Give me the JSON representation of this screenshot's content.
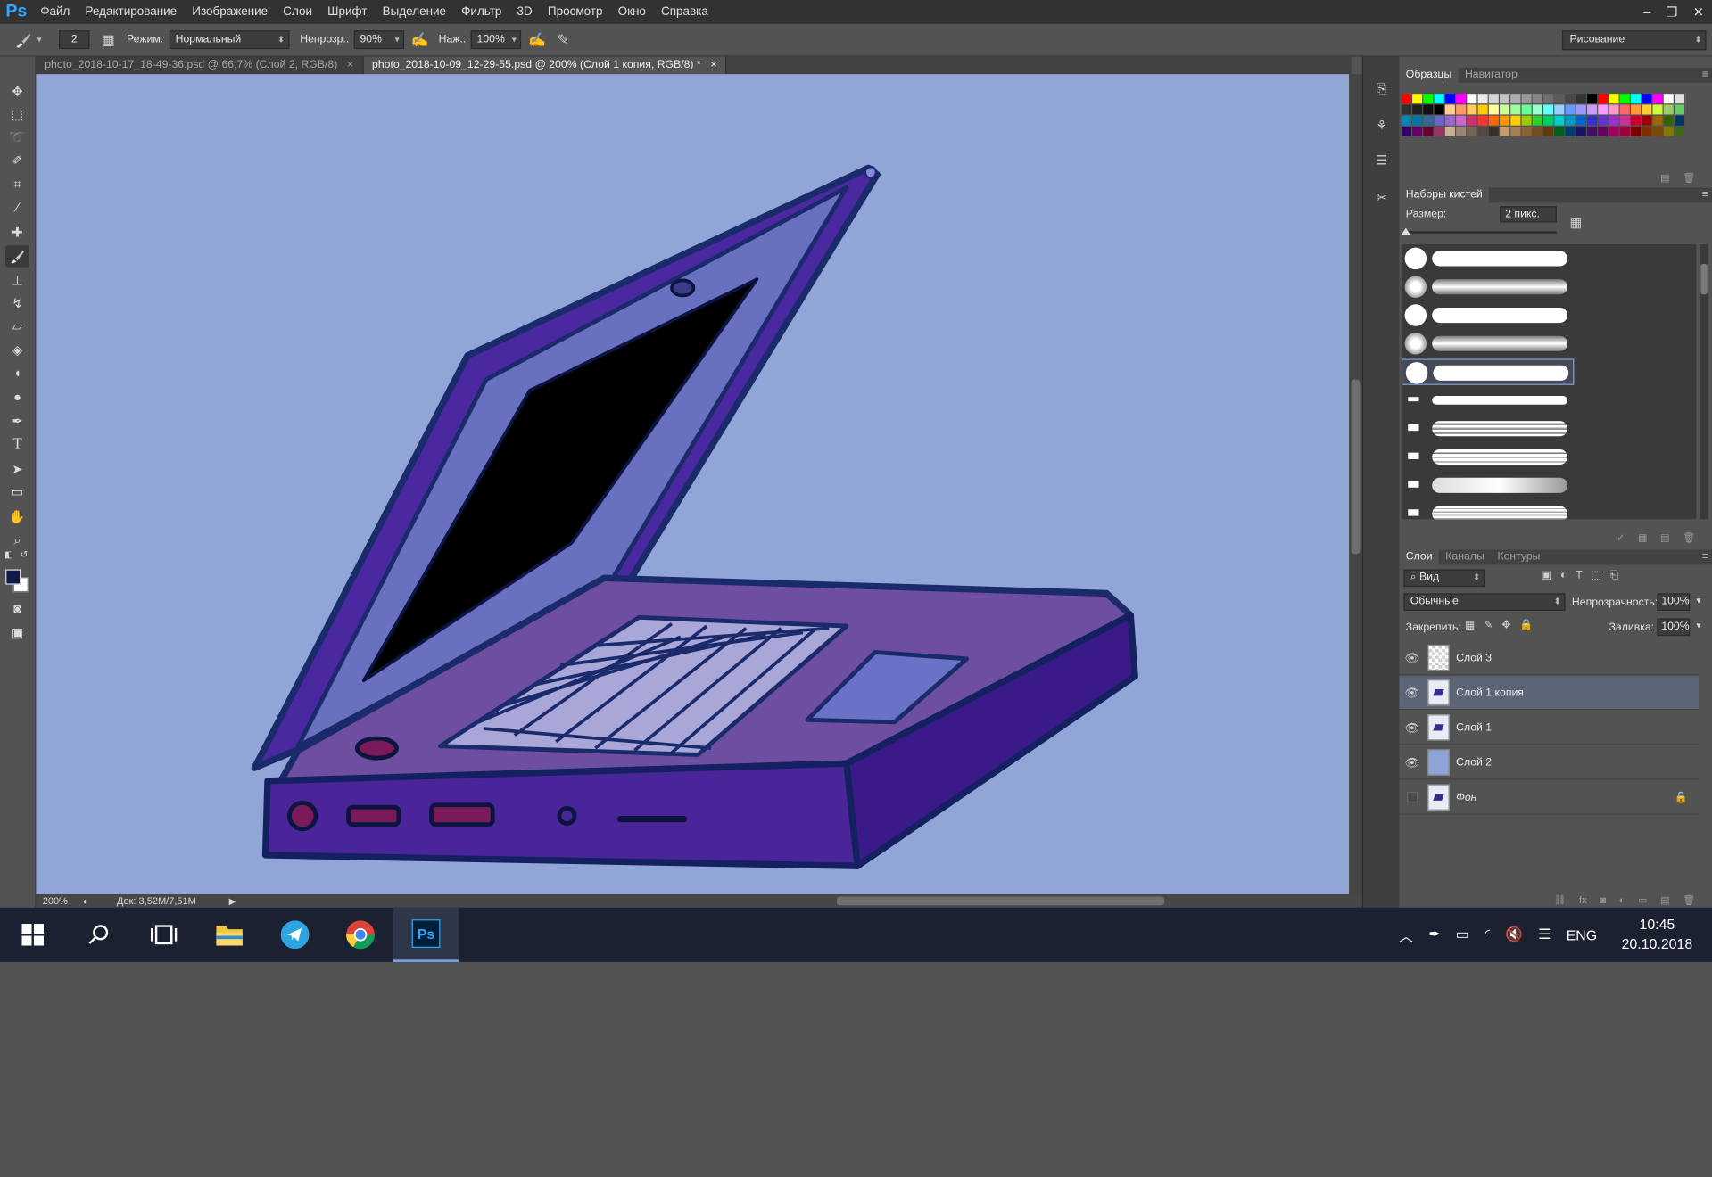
{
  "app": {
    "logo": "Ps"
  },
  "menu": [
    "Файл",
    "Редактирование",
    "Изображение",
    "Слои",
    "Шрифт",
    "Выделение",
    "Фильтр",
    "3D",
    "Просмотр",
    "Окно",
    "Справка"
  ],
  "window_controls": {
    "minimize": "‒",
    "restore": "❐",
    "close": "✕"
  },
  "options": {
    "brush_size": "2",
    "mode_label": "Режим:",
    "mode_value": "Нормальный",
    "opacity_label": "Непрозр.:",
    "opacity_value": "90%",
    "pressure_label": "Наж.:",
    "pressure_value": "100%",
    "workspace": "Рисование"
  },
  "tabs": [
    {
      "label": "photo_2018-10-17_18-49-36.psd @ 66,7% (Слой 2, RGB/8)",
      "close": "×"
    },
    {
      "label": "photo_2018-10-09_12-29-55.psd @ 200% (Слой 1 копия, RGB/8) *",
      "close": "×"
    }
  ],
  "status": {
    "zoom": "200%",
    "doc": "Док: 3,52M/7,51M"
  },
  "swatches_panel": {
    "tabs": [
      "Образцы",
      "Навигатор"
    ],
    "colors": [
      [
        "#ff0000",
        "#ffff00",
        "#00ff00",
        "#00ffff",
        "#0000ff",
        "#ff00ff",
        "#ffffff",
        "#ebebeb",
        "#d6d6d6",
        "#c2c2c2",
        "#adadad",
        "#999999",
        "#858585",
        "#707070",
        "#5c5c5c",
        "#474747",
        "#333333",
        "#000000",
        "#ff0000",
        "#ffff00",
        "#00ff00",
        "#00ffff",
        "#0000ff",
        "#ff00ff",
        "#ffffff",
        "#e0e0e0"
      ],
      [
        "#303030",
        "#202020",
        "#101010",
        "#000000",
        "#ffcc99",
        "#ff9966",
        "#ffcc66",
        "#ffcc00",
        "#ffff99",
        "#ccff99",
        "#99ff99",
        "#66ff99",
        "#99ffcc",
        "#66ffff",
        "#99ccff",
        "#6699ff",
        "#9999ff",
        "#cc99ff",
        "#ff99ff",
        "#ff99cc",
        "#ff6666",
        "#ff9933",
        "#ffcc33",
        "#ccff33",
        "#99cc66",
        "#66cc66"
      ],
      [
        "#0088bb",
        "#0077aa",
        "#336699",
        "#6666cc",
        "#9966cc",
        "#cc66cc",
        "#cc3366",
        "#ff3333",
        "#ff6600",
        "#ff9900",
        "#ffcc00",
        "#99cc00",
        "#33cc33",
        "#00cc66",
        "#00cccc",
        "#0099cc",
        "#0066cc",
        "#3333cc",
        "#6633cc",
        "#9933cc",
        "#cc3399",
        "#cc0033",
        "#990000",
        "#996600",
        "#336600",
        "#003366"
      ],
      [
        "#330066",
        "#660066",
        "#660033",
        "#993366",
        "#c7b299",
        "#998675",
        "#736357",
        "#534741",
        "#362f2d",
        "#c69c6d",
        "#a67c52",
        "#8c6239",
        "#754c24",
        "#603913",
        "#005e20",
        "#003c6e",
        "#1b1464",
        "#440e62",
        "#630460",
        "#9e005d",
        "#9e0039",
        "#790000",
        "#7b2e00",
        "#7d4900",
        "#827b00",
        "#406618"
      ]
    ]
  },
  "brushes_panel": {
    "title": "Наборы кистей",
    "size_label": "Размер:",
    "size_value": "2 пикс."
  },
  "layers_panel": {
    "tabs": [
      "Слои",
      "Каналы",
      "Контуры"
    ],
    "filter_value": "Вид",
    "blend_mode": "Обычные",
    "opacity_label": "Непрозрачность:",
    "opacity_value": "100%",
    "lock_label": "Закрепить:",
    "fill_label": "Заливка:",
    "fill_value": "100%",
    "layers": [
      {
        "name": "Слой 3",
        "visible": true,
        "thumb": "checker",
        "selected": false
      },
      {
        "name": "Слой 1 копия",
        "visible": true,
        "thumb": "art",
        "selected": true
      },
      {
        "name": "Слой 1",
        "visible": true,
        "thumb": "art",
        "selected": false
      },
      {
        "name": "Слой 2",
        "visible": true,
        "thumb": "blue",
        "selected": false
      },
      {
        "name": "Фон",
        "visible": false,
        "thumb": "art",
        "selected": false,
        "locked": true
      }
    ]
  },
  "taskbar": {
    "apps": [
      "windows-start",
      "search",
      "task-view",
      "file-explorer",
      "telegram",
      "chrome",
      "photoshop"
    ],
    "language": "ENG",
    "time": "10:45",
    "date": "20.10.2018"
  }
}
